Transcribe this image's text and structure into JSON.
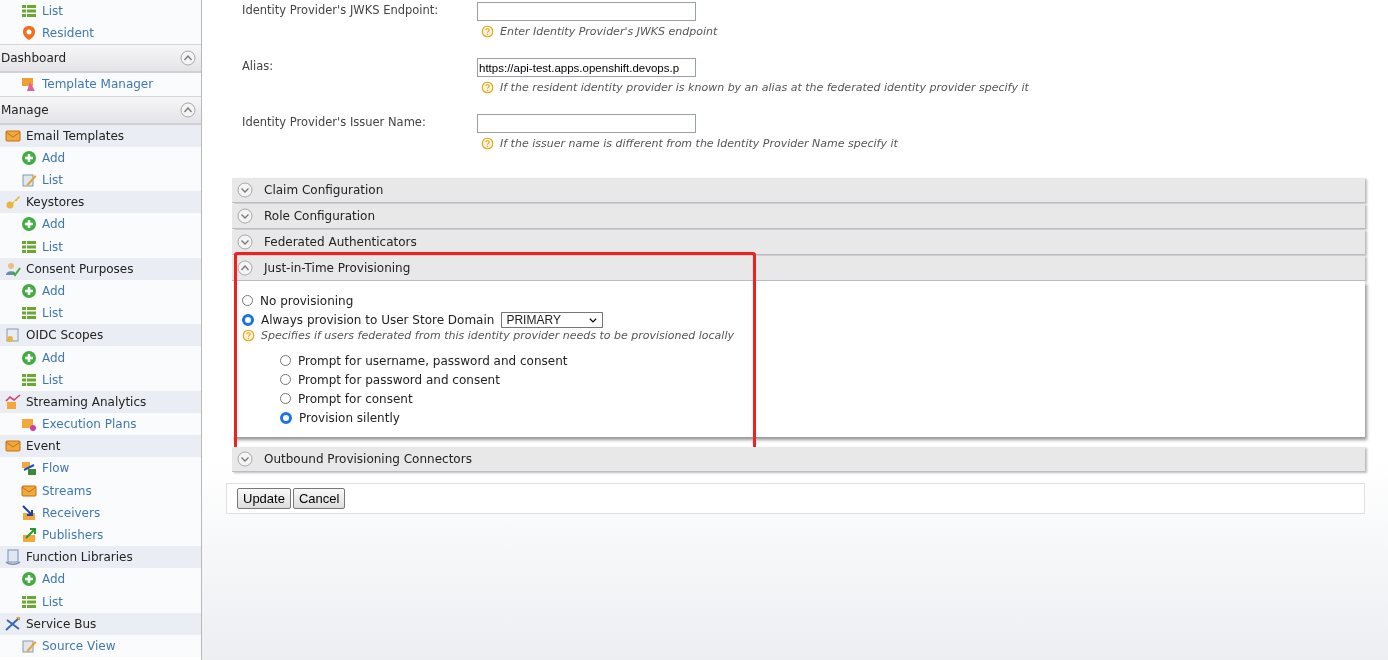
{
  "sidebar": {
    "items": [
      {
        "kind": "link",
        "label": "List"
      },
      {
        "kind": "link",
        "label": "Resident"
      },
      {
        "kind": "section",
        "label": "Dashboard",
        "expanded": true
      },
      {
        "kind": "link",
        "label": "Template Manager"
      },
      {
        "kind": "section",
        "label": "Manage",
        "expanded": true
      },
      {
        "kind": "group",
        "label": "Email Templates"
      },
      {
        "kind": "link",
        "label": "Add"
      },
      {
        "kind": "link",
        "label": "List"
      },
      {
        "kind": "group",
        "label": "Keystores"
      },
      {
        "kind": "link",
        "label": "Add"
      },
      {
        "kind": "link",
        "label": "List"
      },
      {
        "kind": "group",
        "label": "Consent Purposes"
      },
      {
        "kind": "link",
        "label": "Add"
      },
      {
        "kind": "link",
        "label": "List"
      },
      {
        "kind": "group",
        "label": "OIDC Scopes"
      },
      {
        "kind": "link",
        "label": "Add"
      },
      {
        "kind": "link",
        "label": "List"
      },
      {
        "kind": "group",
        "label": "Streaming Analytics"
      },
      {
        "kind": "link",
        "label": "Execution Plans"
      },
      {
        "kind": "group",
        "label": "Event"
      },
      {
        "kind": "link",
        "label": "Flow"
      },
      {
        "kind": "link",
        "label": "Streams"
      },
      {
        "kind": "link",
        "label": "Receivers"
      },
      {
        "kind": "link",
        "label": "Publishers"
      },
      {
        "kind": "group",
        "label": "Function Libraries"
      },
      {
        "kind": "link",
        "label": "Add"
      },
      {
        "kind": "link",
        "label": "List"
      },
      {
        "kind": "group",
        "label": "Service Bus"
      },
      {
        "kind": "link",
        "label": "Source View"
      }
    ]
  },
  "fields": [
    {
      "label": "Identity Provider's JWKS Endpoint:",
      "help": "Enter Identity Provider's JWKS endpoint"
    },
    {
      "label": "Alias:",
      "value": "https://api-test.apps.openshift.devops.p",
      "help": "If the resident identity provider is known by an alias at the federated identity provider specify it"
    },
    {
      "label": "Identity Provider's Issuer Name:",
      "help": "If the issuer name is different from the Identity Provider Name specify it"
    }
  ],
  "panels": [
    {
      "title": "Claim Configuration",
      "expanded": false
    },
    {
      "title": "Role Configuration",
      "expanded": false
    },
    {
      "title": "Federated Authenticators",
      "expanded": false
    },
    {
      "title": "Just-in-Time Provisioning",
      "expanded": true,
      "highlighted": true,
      "body": {
        "options": [
          {
            "label": "No provisioning",
            "selected": false
          },
          {
            "label": "Always provision to User Store Domain",
            "selected": true,
            "domain": "PRIMARY"
          }
        ],
        "help": "Specifies if users federated from this identity provider needs to be provisioned locally",
        "prompt_options": [
          {
            "label": "Prompt for username, password and consent",
            "selected": false
          },
          {
            "label": "Prompt for password and consent",
            "selected": false
          },
          {
            "label": "Prompt for consent",
            "selected": false
          },
          {
            "label": "Provision silently",
            "selected": true
          }
        ]
      }
    },
    {
      "title": "Outbound Provisioning Connectors",
      "expanded": false
    }
  ],
  "buttons": [
    "Update",
    "Cancel"
  ]
}
